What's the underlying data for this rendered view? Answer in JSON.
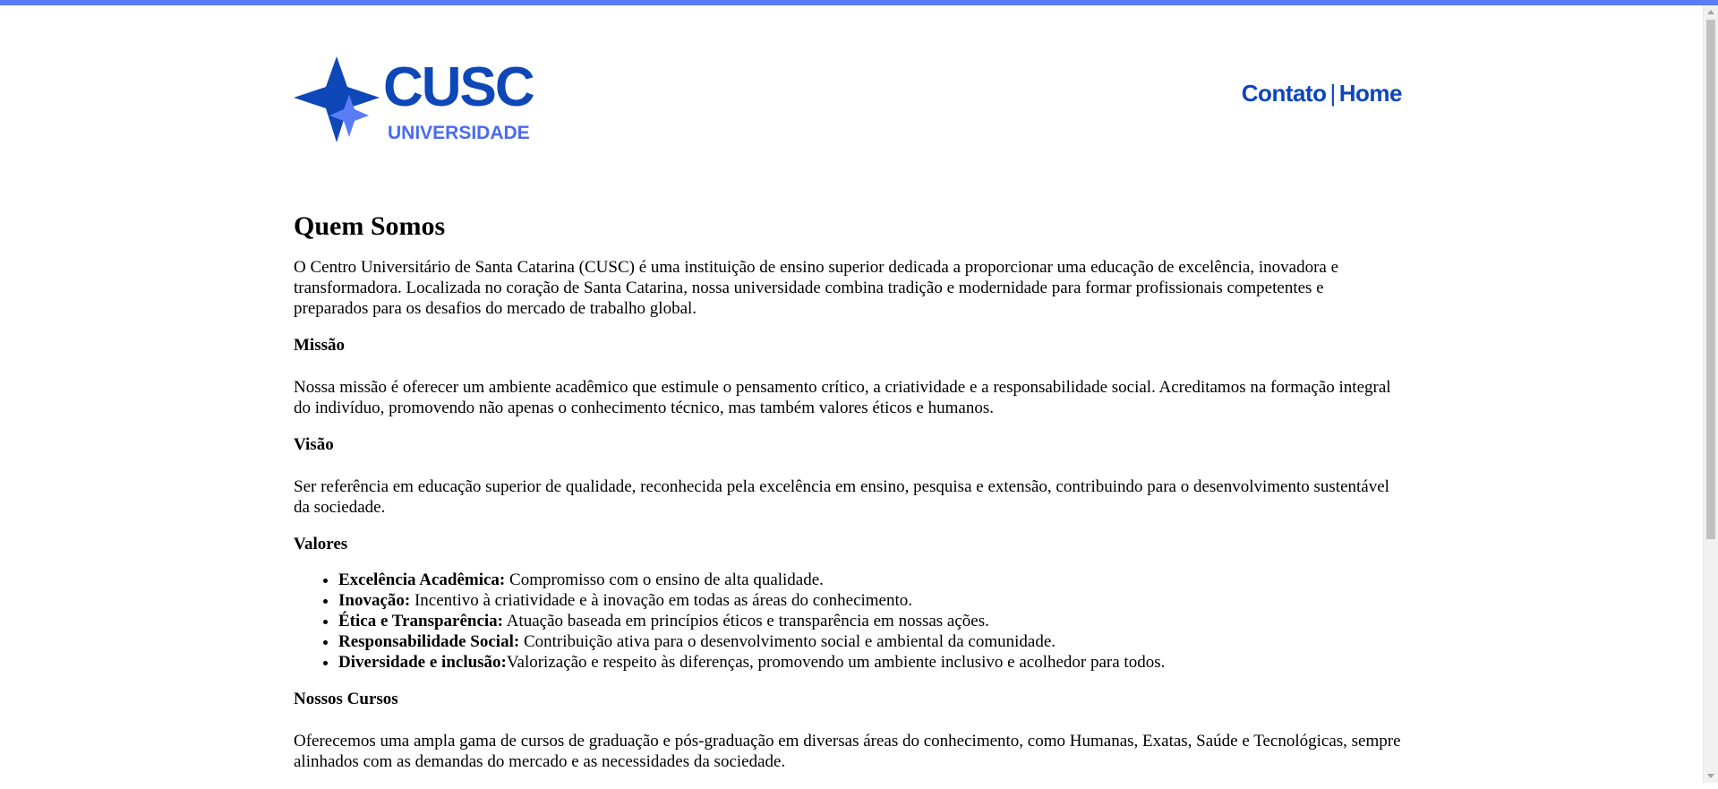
{
  "colors": {
    "accent_bar": "#5a7cf6",
    "brand_dark": "#0d47b8",
    "brand_light": "#4a6bf0"
  },
  "logo": {
    "main_text": "CUSC",
    "sub_text": "UNIVERSIDADE",
    "icon": "star-icon"
  },
  "nav": {
    "contato": "Contato",
    "separator": "|",
    "home": "Home"
  },
  "content": {
    "title": "Quem Somos",
    "intro": "O Centro Universitário de Santa Catarina (CUSC) é uma instituição de ensino superior dedicada a proporcionar uma educação de excelência, inovadora e transformadora. Localizada no coração de Santa Catarina, nossa universidade combina tradição e modernidade para formar profissionais competentes e preparados para os desafios do mercado de trabalho global.",
    "missao_heading": "Missão",
    "missao_text": "Nossa missão é oferecer um ambiente acadêmico que estimule o pensamento crítico, a criatividade e a responsabilidade social. Acreditamos na formação integral do indivíduo, promovendo não apenas o conhecimento técnico, mas também valores éticos e humanos.",
    "visao_heading": "Visão",
    "visao_text": "Ser referência em educação superior de qualidade, reconhecida pela excelência em ensino, pesquisa e extensão, contribuindo para o desenvolvimento sustentável da sociedade.",
    "valores_heading": "Valores",
    "valores": [
      {
        "label": "Excelência Acadêmica:",
        "text": " Compromisso com o ensino de alta qualidade."
      },
      {
        "label": "Inovação:",
        "text": " Incentivo à criatividade e à inovação em todas as áreas do conhecimento."
      },
      {
        "label": "Ética e Transparência:",
        "text": " Atuação baseada em princípios éticos e transparência em nossas ações."
      },
      {
        "label": "Responsabilidade Social:",
        "text": " Contribuição ativa para o desenvolvimento social e ambiental da comunidade."
      },
      {
        "label": "Diversidade e inclusão:",
        "text": "Valorização e respeito às diferenças, promovendo um ambiente inclusivo e acolhedor para todos."
      }
    ],
    "cursos_heading": "Nossos Cursos",
    "cursos_text": "Oferecemos uma ampla gama de cursos de graduação e pós-graduação em diversas áreas do conhecimento, como Humanas, Exatas, Saúde e Tecnológicas, sempre alinhados com as demandas do mercado e as necessidades da sociedade."
  }
}
